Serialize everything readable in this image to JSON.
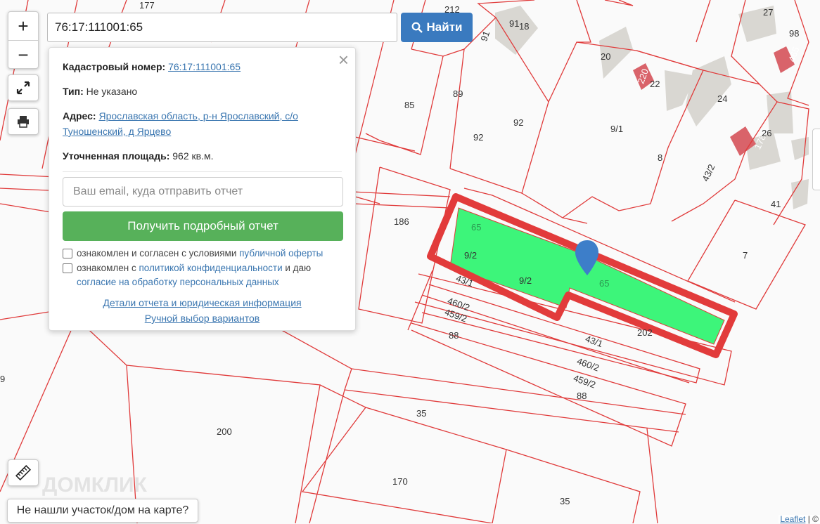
{
  "search": {
    "value": "76:17:111001:65",
    "button_label": "Найти"
  },
  "zoom": {
    "in": "+",
    "out": "−"
  },
  "popup": {
    "cadastral_label": "Кадастровый номер:",
    "cadastral_value": "76:17:111001:65",
    "type_label": "Тип:",
    "type_value": "Не указано",
    "address_label": "Адрес:",
    "address_line1": "Ярославская область, р-н Ярославский, с/о",
    "address_line2": "Туношенский, д Ярцево",
    "area_label": "Уточненная площадь:",
    "area_value": "962 кв.м.",
    "email_placeholder": "Ваш email, куда отправить отчет",
    "report_button": "Получить подробный отчет",
    "offer_text": "ознакомлен и согласен с условиями ",
    "offer_link": "публичной оферты",
    "privacy_text": "ознакомлен с ",
    "privacy_link": "политикой конфиденциальности",
    "privacy_text2": " и даю",
    "consent_link": "согласие на обработку персональных данных",
    "details_link": "Детали отчета и юридическая информация",
    "manual_link": "Ручной выбор вариантов"
  },
  "not_found_button": "Не нашли участок/дом на карте?",
  "attribution": {
    "leaflet": "Leaflet",
    "sep": " | ©"
  },
  "watermark": "ДОМКЛИК",
  "map_labels": [
    "177",
    "212",
    "91",
    "18",
    "98",
    "27",
    "20",
    "220",
    "22",
    "465",
    "85",
    "89",
    "24",
    "92",
    "92",
    "9/1",
    "8",
    "178",
    "26",
    "43/2",
    "186",
    "41",
    "65",
    "9/2",
    "9/2",
    "65",
    "7",
    "43/1",
    "460/2",
    "459/2",
    "88",
    "202",
    "43/1",
    "460/2",
    "459/2",
    "88",
    "9",
    "35",
    "200",
    "170",
    "35"
  ],
  "colors": {
    "parcel_line": "#e03a3a",
    "selected_fill": "#3df57a",
    "highlight": "#e23b3b",
    "building": "#d9d7d2",
    "building_red": "#d9636a",
    "search_button": "#3a7abf",
    "report_button": "#57b15a"
  }
}
